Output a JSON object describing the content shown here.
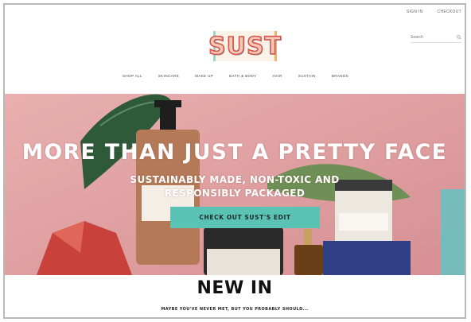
{
  "header": {
    "top_links": [
      "SIGN IN",
      "CHECKOUT"
    ],
    "search_placeholder": "Search",
    "logo_text": "SUST",
    "nav": [
      "SHOP ALL",
      "SKINCARE",
      "MAKE UP",
      "BATH & BODY",
      "HAIR",
      "SUSTAIN",
      "BRANDS"
    ]
  },
  "hero": {
    "title": "MORE THAN JUST A PRETTY FACE",
    "subtitle": "SUSTAINABLY MADE, NON-TOXIC AND RESPONSIBLY PACKAGED",
    "button_label": "CHECK OUT SUST'S EDIT",
    "colors": {
      "background": "#e3a5a6",
      "button": "#5ac3b6"
    }
  },
  "new_in": {
    "title": "NEW IN",
    "subtitle": "MAYBE YOU'VE NEVER MET, BUT YOU PROBABLY SHOULD..."
  },
  "icons": {
    "search": "search-icon"
  }
}
